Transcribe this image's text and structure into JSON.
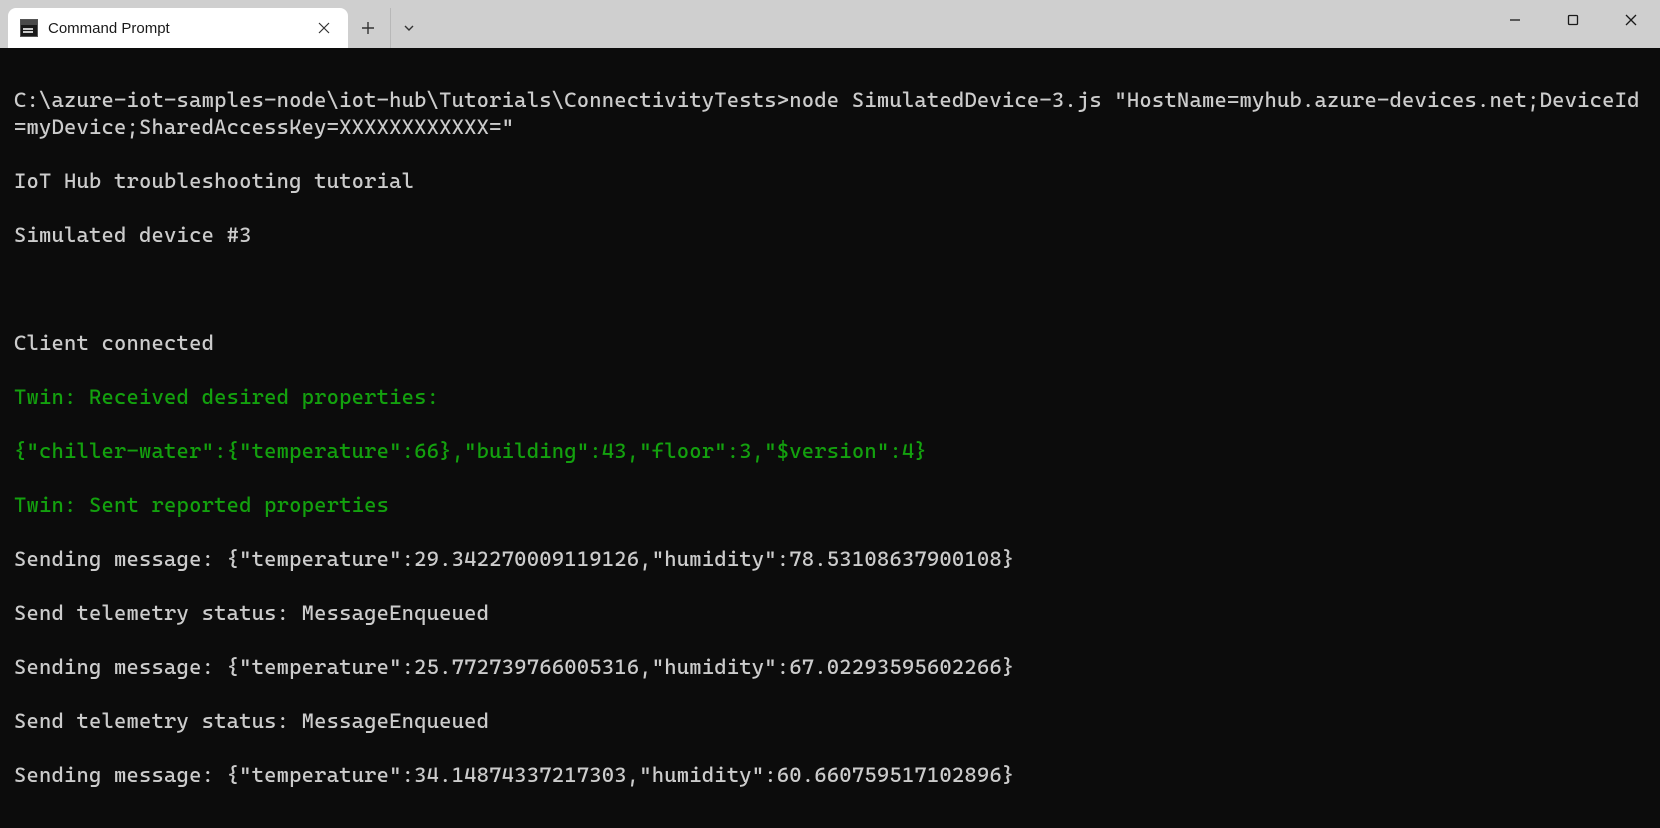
{
  "titlebar": {
    "tab_title": "Command Prompt"
  },
  "terminal": {
    "command_line": "C:\\azure-iot-samples-node\\iot-hub\\Tutorials\\ConnectivityTests>node SimulatedDevice-3.js \"HostName=myhub.azure-devices.net;DeviceId=myDevice;SharedAccessKey=XXXXXXXXXXXX=\"",
    "line_tutorial": "IoT Hub troubleshooting tutorial",
    "line_device": "Simulated device #3",
    "line_blank": "",
    "line_connected": "Client connected",
    "line_twin_recv": "Twin: Received desired properties:",
    "line_twin_json": "{\"chiller-water\":{\"temperature\":66},\"building\":43,\"floor\":3,\"$version\":4}",
    "line_twin_sent": "Twin: Sent reported properties",
    "line_send1": "Sending message: {\"temperature\":29.342270009119126,\"humidity\":78.53108637900108}",
    "line_status1": "Send telemetry status: MessageEnqueued",
    "line_send2": "Sending message: {\"temperature\":25.772739766005316,\"humidity\":67.02293595602266}",
    "line_status2": "Send telemetry status: MessageEnqueued",
    "line_send3": "Sending message: {\"temperature\":34.14874337217303,\"humidity\":60.660759517102896}"
  }
}
